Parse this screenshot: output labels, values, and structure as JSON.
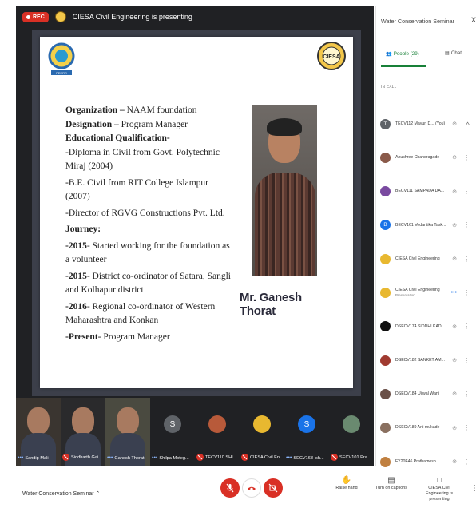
{
  "topbar": {
    "rec_label": "REC",
    "presenting_text": "CIESA Civil Engineering is presenting"
  },
  "slide": {
    "logo_left_text": "PEERR",
    "logo_right_text": "CIESA",
    "lines": [
      {
        "bold": "Organization – ",
        "text": "NAAM foundation"
      },
      {
        "bold": "Designation – ",
        "text": "Program Manager"
      },
      {
        "bold": "Educational Qualification-",
        "text": ""
      },
      {
        "bold": "",
        "text": "-Diploma in Civil from Govt. Polytechnic Miraj (2004)"
      },
      {
        "bold": "",
        "text": "-B.E. Civil from RIT College Islampur (2007)"
      },
      {
        "bold": "",
        "text": "-Director of RGVG Constructions Pvt. Ltd."
      },
      {
        "bold": "Journey:",
        "text": ""
      },
      {
        "bold": "-2015",
        "text": "- Started working for the foundation as a volunteer"
      },
      {
        "bold": "-2015",
        "text": "- District co-ordinator of Satara, Sangli and Kolhapur district"
      },
      {
        "bold": "-2016",
        "text": "- Regional co-ordinator of Western Maharashtra and Konkan"
      },
      {
        "bold": "-Present",
        "text": "- Program Manager"
      }
    ],
    "speaker_name": "Mr. Ganesh Thorat"
  },
  "filmstrip": [
    {
      "label": "Sandip Mali",
      "kind": "video",
      "bg": "#3a3530",
      "mic": "dots"
    },
    {
      "label": "Siddharth Gai...",
      "kind": "video",
      "bg": "#2a2a2c",
      "mic": "off"
    },
    {
      "label": "Ganesh Thorat",
      "kind": "video",
      "bg": "#4a4a40",
      "mic": "dots"
    },
    {
      "label": "Shilpa Moteg...",
      "kind": "avatar",
      "initial": "S",
      "color": "#5f6368",
      "mic": "dots"
    },
    {
      "label": "TECV110 SHI...",
      "kind": "avatar",
      "initial": "",
      "color": "#b85a3a",
      "mic": "off"
    },
    {
      "label": "CIESA Civil En...",
      "kind": "avatar",
      "initial": "",
      "color": "#e8b830",
      "mic": "off"
    },
    {
      "label": "SECV168 Ish...",
      "kind": "avatar",
      "initial": "S",
      "color": "#1a73e8",
      "mic": "dots"
    },
    {
      "label": "SECV101 Pra...",
      "kind": "avatar",
      "initial": "",
      "color": "#6a8a70",
      "mic": "off"
    }
  ],
  "bottombar": {
    "meeting_name": "Water Conservation Seminar",
    "raise_hand": "Raise hand",
    "captions": "Turn on captions",
    "presenting": "CIESA Civil Engineering is presenting"
  },
  "panel": {
    "title": "Water Conservation Seminar",
    "close": "X",
    "people_tab": "People (29)",
    "chat_tab": "Chat",
    "in_call_label": "IN CALL",
    "participants": [
      {
        "name": "TECV112 Mayuri D... (You)",
        "sub": "",
        "initial": "T",
        "color": "#5f6368",
        "mic": "muted",
        "action": "pin"
      },
      {
        "name": "Anushree Chandragade",
        "sub": "",
        "initial": "",
        "color": "#8a5a4a",
        "mic": "muted",
        "action": "more"
      },
      {
        "name": "BECV111 SAMPADA DA...",
        "sub": "",
        "initial": "",
        "color": "#7a4aa0",
        "mic": "muted",
        "action": "more"
      },
      {
        "name": "BECV161 Vedantika Task...",
        "sub": "",
        "initial": "B",
        "color": "#1a73e8",
        "mic": "muted",
        "action": "more"
      },
      {
        "name": "CIESA Civil Engineering",
        "sub": "",
        "initial": "",
        "color": "#e8b830",
        "mic": "muted",
        "action": "more"
      },
      {
        "name": "CIESA Civil Engineering",
        "sub": "Presentation",
        "initial": "",
        "color": "#e8b830",
        "mic": "dots",
        "action": "more"
      },
      {
        "name": "DSECV174 SIDDHI KAD...",
        "sub": "",
        "initial": "",
        "color": "#111111",
        "mic": "muted",
        "action": "more"
      },
      {
        "name": "DSECV182 SANKET AM...",
        "sub": "",
        "initial": "",
        "color": "#a03a30",
        "mic": "muted",
        "action": "more"
      },
      {
        "name": "DSECV184 Ujjwal Wani",
        "sub": "",
        "initial": "",
        "color": "#6a5048",
        "mic": "muted",
        "action": "more"
      },
      {
        "name": "DSECV189 Arti mukade",
        "sub": "",
        "initial": "",
        "color": "#8a7060",
        "mic": "muted",
        "action": "more"
      },
      {
        "name": "FY20F46 Prathamesh ...",
        "sub": "",
        "initial": "",
        "color": "#c08040",
        "mic": "muted",
        "action": "more"
      }
    ]
  }
}
